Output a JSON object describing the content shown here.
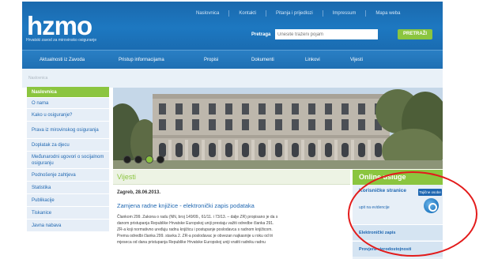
{
  "header": {
    "logo": "hzmo",
    "logo_subtitle": "Hrvatski zavod za mirovinsko osiguranje",
    "top_links": [
      "Naslovnica",
      "Kontakti",
      "Pitanja i prijedlozi",
      "Impressum",
      "Mapa weba"
    ],
    "search_label": "Pretraga",
    "search_placeholder": "Unesite traženi pojam",
    "search_button": "PRETRAŽI"
  },
  "nav": {
    "items": [
      "Aktualnosti iz Zavoda",
      "Pristup informacijama",
      "Propisi",
      "Dokumenti",
      "Linkovi",
      "Vijesti"
    ]
  },
  "breadcrumb": "Naslovnica",
  "sidebar": {
    "items": [
      {
        "label": "Naslovnica",
        "active": true
      },
      {
        "label": "O nama"
      },
      {
        "label": "Kako u osiguranje?"
      },
      {
        "label": "Prava iz mirovinskog osiguranja"
      },
      {
        "label": "Doplatak za djecu"
      },
      {
        "label": "Međunarodni ugovori o socijalnom osiguranju"
      },
      {
        "label": "Podnošenje zahtjeva"
      },
      {
        "label": "Statistika"
      },
      {
        "label": "Publikacije"
      },
      {
        "label": "Tiskanice"
      },
      {
        "label": "Javna nabava"
      }
    ]
  },
  "hero": {
    "slides": 4,
    "active_slide": 3
  },
  "news": {
    "section_title": "Vijesti",
    "date": "Zagreb, 28.06.2013.",
    "title": "Zamjena radne knjižice - elektronički zapis podataka",
    "body_lines": [
      "Člankom 299. Zakona o radu (NN, broj 149/09., 61/11. i 73/13. – dalje ZR) propisano je da s",
      "danom pristupanja Republike Hrvatske Europskoj uniji prestaju važiti odredbe članka 291.",
      "ZR-a koji normativno uređuju radnu knjižicu i postupanje poslodavca s radnom knjižicom.",
      "Prema odredbi članka 299. stavka 2. ZR-a poslodavac je obvezan najkasnije u roku od tri",
      "mjeseca od dana pristupanja Republike Hrvatske Europskoj uniji vratiti radniku radnu"
    ]
  },
  "online_services": {
    "title": "Online usluge",
    "user_title": "Korisničke stranice",
    "user_sub": "upit na evidencije",
    "badge": "Tajične osobe",
    "rows": [
      "Elektronički zapis",
      "Provjera vjerodostojnosti"
    ]
  },
  "colors": {
    "brand_blue": "#1d78c1",
    "accent_green": "#8bc53f",
    "annotation_red": "#e31b1b"
  }
}
